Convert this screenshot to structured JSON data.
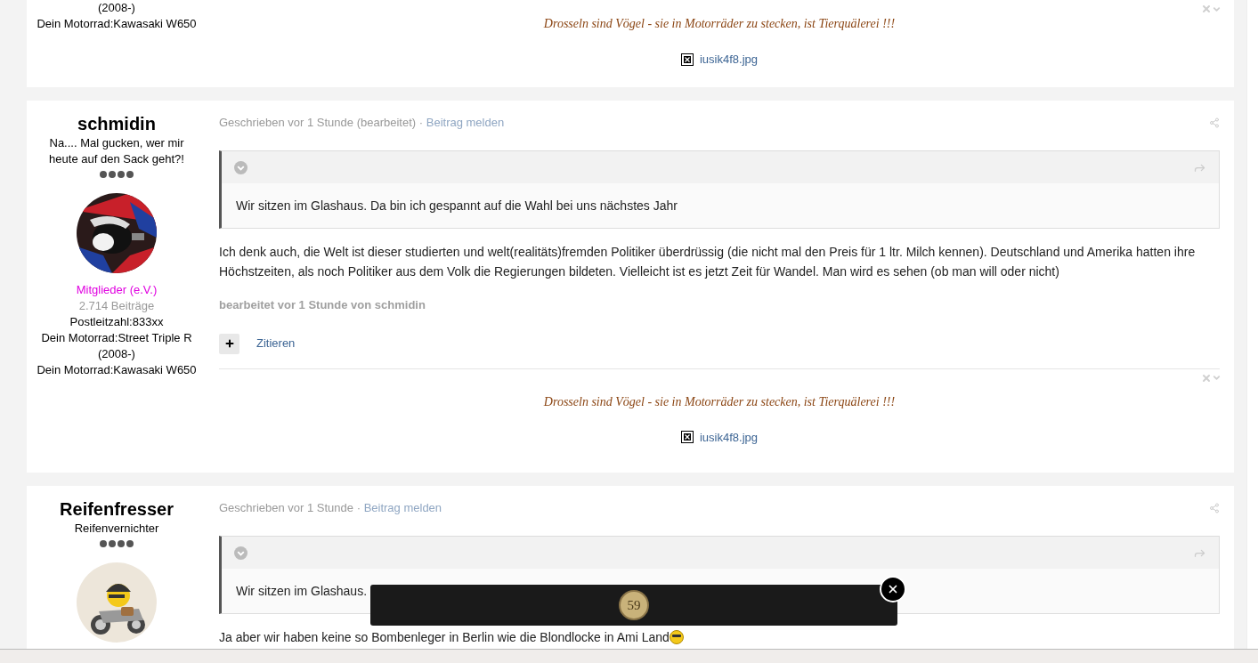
{
  "posts": [
    {
      "author": {
        "fields": [
          "(2008-)",
          "Dein Motorrad:Kawasaki W650"
        ]
      },
      "signature": "Drosseln sind Vögel - sie in Motorräder zu stecken, ist Tierquälerei !!!",
      "attachment": "iusik4f8.jpg"
    },
    {
      "author": {
        "name": "schmidin",
        "title": "Na.... Mal gucken, wer mir heute auf den Sack geht?!",
        "stars": 4,
        "group": "Mitglieder (e.V.)",
        "post_count": "2.714 Beiträge",
        "fields": [
          "Postleitzahl:833xx",
          "Dein Motorrad:Street Triple R (2008-)",
          "Dein Motorrad:Kawasaki W650"
        ]
      },
      "meta": "Geschrieben vor 1 Stunde (bearbeitet)",
      "separator": "·",
      "report_link": "Beitrag melden",
      "quote": "Wir sitzen im Glashaus. Da bin ich gespannt auf die Wahl bei uns nächstes Jahr",
      "body": "Ich denk auch, die Welt ist dieser studierten und welt(realitäts)fremden Politiker überdrüssig (die nicht mal den Preis für 1 ltr. Milch kennen). Deutschland und Amerika hatten ihre Höchstzeiten, als noch Politiker aus dem Volk die Regierungen bildeten. Vielleicht ist es jetzt Zeit für Wandel. Man wird es sehen (ob man will oder nicht)",
      "edited_note": "bearbeitet vor 1 Stunde von schmidin",
      "quote_button": "Zitieren",
      "signature": "Drosseln sind Vögel - sie in Motorräder zu stecken, ist Tierquälerei !!!",
      "attachment": "iusik4f8.jpg"
    },
    {
      "author": {
        "name": "Reifenfresser",
        "title": "Reifenvernichter",
        "stars": 4
      },
      "meta": "Geschrieben vor 1 Stunde",
      "separator": "·",
      "report_link": "Beitrag melden",
      "quote": "Wir sitzen im Glashaus.",
      "body": "Ja aber wir haben keine so Bombenleger in Berlin wie die Blondlocke in Ami Land",
      "body_emoji": true
    }
  ],
  "overlay": {
    "badge": "59"
  }
}
